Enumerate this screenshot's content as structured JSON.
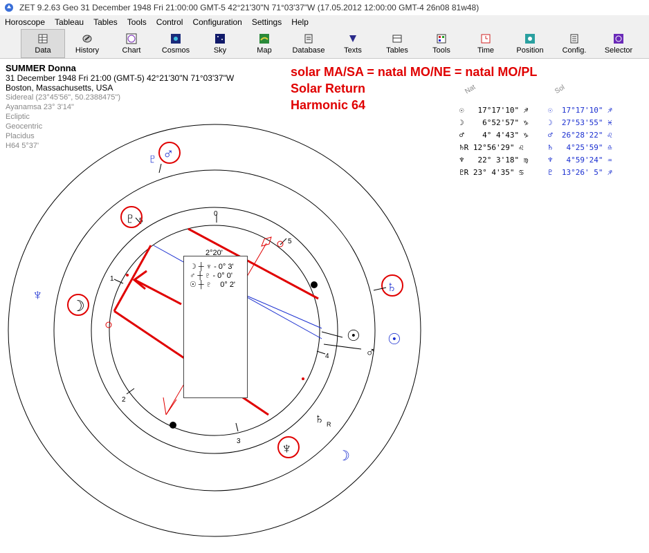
{
  "window": {
    "title": "ZET 9.2.63 Geo   31 December 1948  Fri  21:00:00 GMT-5 42°21'30\"N  71°03'37\"W  (17.05.2012  12:00:00 GMT-4 26n08 81w48)"
  },
  "menu": [
    "Horoscope",
    "Tableau",
    "Tables",
    "Tools",
    "Control",
    "Configuration",
    "Settings",
    "Help"
  ],
  "toolbar": [
    {
      "label": "Data",
      "icon": "data-icon",
      "active": true
    },
    {
      "label": "History",
      "icon": "history-icon"
    },
    {
      "label": "Chart",
      "icon": "chart-icon"
    },
    {
      "label": "Cosmos",
      "icon": "cosmos-icon"
    },
    {
      "label": "Sky",
      "icon": "sky-icon"
    },
    {
      "label": "Map",
      "icon": "map-icon"
    },
    {
      "label": "Database",
      "icon": "database-icon"
    },
    {
      "label": "Texts",
      "icon": "texts-icon"
    },
    {
      "label": "Tables",
      "icon": "tables-icon"
    },
    {
      "label": "Tools",
      "icon": "tools-icon"
    },
    {
      "label": "Time",
      "icon": "time-icon"
    },
    {
      "label": "Position",
      "icon": "position-icon"
    },
    {
      "label": "Config.",
      "icon": "config-icon"
    },
    {
      "label": "Selector",
      "icon": "selector-icon"
    }
  ],
  "info": {
    "name": "SUMMER Donna",
    "date": "31 December 1948  Fri  21:00 (GMT-5) 42°21'30\"N  71°03'37\"W",
    "place": "Boston, Massachusetts, USA",
    "settings": [
      "Sidereal (23°45'56\", 50.2388475\")",
      "Ayanamsa 23° 3'14\"",
      "Ecliptic",
      "Geocentric",
      "Placidus",
      "H64   5°37'"
    ]
  },
  "annotation": [
    "solar MA/SA = natal MO/NE = natal MO/PL",
    "Solar Return",
    "Harmonic 64"
  ],
  "table": {
    "nat_header": "Nat",
    "sol_header": "Sol",
    "rows": [
      {
        "nat": "☉   17°17'10\" ♐",
        "sol": "☉  17°17'10\" ♐"
      },
      {
        "nat": "☽    6°52'57\" ♑",
        "sol": "☽  27°53'55\" ♓"
      },
      {
        "nat": "♂    4° 4'43\" ♑",
        "sol": "♂  26°28'22\" ♌"
      },
      {
        "nat": "♄R 12°56'29\" ♌",
        "sol": "♄   4°25'59\" ♎"
      },
      {
        "nat": "♆   22° 3'18\" ♍",
        "sol": "♆   4°59'24\" ♒"
      },
      {
        "nat": "♇R 23° 4'35\" ♋",
        "sol": "♇  13°26' 5\" ♐"
      }
    ]
  },
  "aspect_box": {
    "title": "2°20'",
    "rows": [
      "☽ ┼ ♆ - 0° 3'",
      "♂ ┼ ♇ - 0° 0'",
      "☉ ┼ ♇    0° 2'"
    ]
  },
  "wheel": {
    "house_labels": [
      "0",
      "1",
      "2",
      "3",
      "4",
      "5",
      "5"
    ],
    "glyphs": {
      "sun_nat": "☉",
      "sun_sol": "☉",
      "mars_nat": "♂",
      "mars_sol": "♂",
      "saturn_nat": "♄",
      "saturn_nat_retro": "R",
      "saturn_sol": "♄",
      "neptune_nat": "♆",
      "neptune_sol": "♆",
      "moon_nat": "☽",
      "moon_sol": "☽",
      "pluto_nat": "♇",
      "pluto_sol": "♇"
    },
    "colors": {
      "natal": "#000000",
      "solar": "#1a2fd0",
      "highlight": "#e00000"
    }
  }
}
